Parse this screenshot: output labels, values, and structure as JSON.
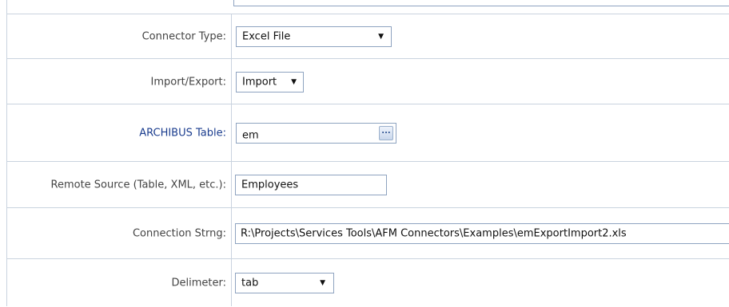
{
  "form": {
    "connector_type": {
      "label": "Connector Type:",
      "value": "Excel File"
    },
    "import_export": {
      "label": "Import/Export:",
      "value": "Import"
    },
    "archibus_table": {
      "label": "ARCHIBUS Table:",
      "value": "em",
      "browse_label": "..."
    },
    "remote_source": {
      "label": "Remote Source (Table, XML, etc.):",
      "value": "Employees"
    },
    "connection_string": {
      "label": "Connection Strng:",
      "value": "R:\\Projects\\Services Tools\\AFM Connectors\\Examples\\emExportImport2.xls"
    },
    "delimeter": {
      "label": "Delimeter:",
      "value": "tab"
    }
  },
  "icons": {
    "dropdown_arrow": "▼"
  },
  "colors": {
    "link_label": "#1a3c8e",
    "border": "#c9d3df",
    "field_border": "#8ea3c0"
  }
}
